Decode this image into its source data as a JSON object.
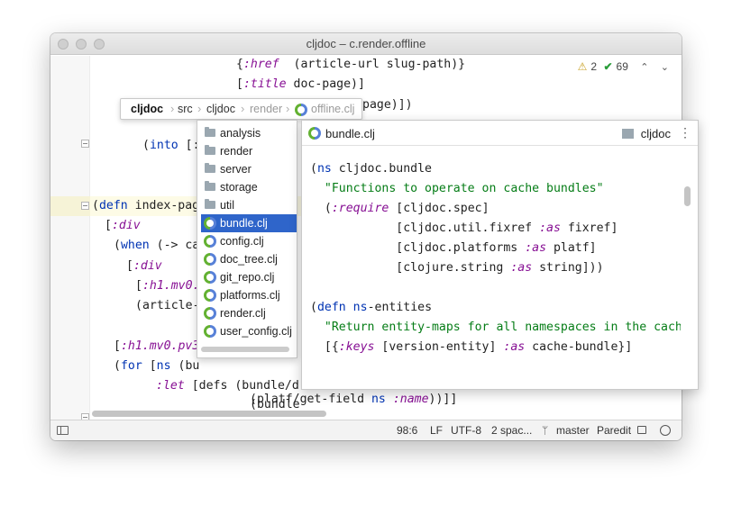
{
  "window": {
    "title": "cljdoc – c.render.offline"
  },
  "inspection": {
    "warnings": "2",
    "ok": "69",
    "warn_icon": "⚠",
    "ok_icon": "✔",
    "up_icon": "⌃",
    "down_icon": "⌄"
  },
  "editor": {
    "lines": [
      "{:href  (article-url slug-path)}",
      "[:title doc-page)]",
      "page)])",
      "(into [:",
      "(defn index-pag",
      "[:div",
      "(when (-> ca",
      "[:div",
      "[:h1.mv0.",
      "(article-",
      "[:h1.mv0.pv3",
      "(for [ns (bu",
      ":let [defs (bundle/d",
      "(bundle",
      "(platf/get-field ns :name))]]"
    ]
  },
  "breadcrumb": {
    "items": [
      "cljdoc",
      "src",
      "cljdoc",
      "render",
      "offline.clj"
    ],
    "separator": "›"
  },
  "file_list": {
    "items": [
      {
        "label": "analysis",
        "icon": "folder-icon"
      },
      {
        "label": "render",
        "icon": "folder-icon"
      },
      {
        "label": "server",
        "icon": "folder-icon"
      },
      {
        "label": "storage",
        "icon": "folder-icon"
      },
      {
        "label": "util",
        "icon": "folder-icon"
      },
      {
        "label": "bundle.clj",
        "icon": "clojure-file-icon",
        "selected": true
      },
      {
        "label": "config.clj",
        "icon": "clojure-file-icon"
      },
      {
        "label": "doc_tree.clj",
        "icon": "clojure-file-icon"
      },
      {
        "label": "git_repo.clj",
        "icon": "clojure-file-icon"
      },
      {
        "label": "platforms.clj",
        "icon": "clojure-file-icon"
      },
      {
        "label": "render.clj",
        "icon": "clojure-file-icon"
      },
      {
        "label": "user_config.clj",
        "icon": "clojure-file-icon"
      }
    ]
  },
  "preview": {
    "file_name": "bundle.clj",
    "project": "cljdoc",
    "more_icon": "⋮",
    "lines": [
      "(ns cljdoc.bundle",
      "  \"Functions to operate on cache bundles\"",
      "  (:require [cljdoc.spec]",
      "            [cljdoc.util.fixref :as fixref]",
      "            [cljdoc.platforms :as platf]",
      "            [clojure.string :as string]))",
      "",
      "(defn ns-entities",
      "  \"Return entity-maps for all namespaces in the cach",
      "  [{:keys [version-entity] :as cache-bundle}]"
    ]
  },
  "status_bar": {
    "position": "98:6",
    "line_separator": "LF",
    "encoding": "UTF-8",
    "indent": "2 spac...",
    "branch_icon": "ᛘ",
    "branch": "master",
    "mode": "Paredit"
  },
  "colors": {
    "keyword": "#0033b3",
    "clj_keyword": "#871094",
    "string": "#067d17",
    "selection": "#2f65ca"
  }
}
